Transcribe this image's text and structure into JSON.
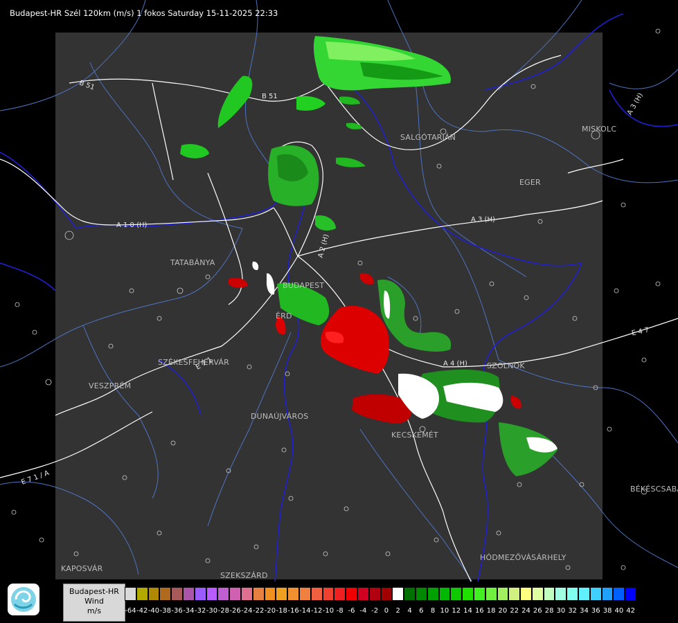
{
  "title": "Budapest-HR Szél 120km (m/s) 1 fokos Saturday 15-11-2025 22:33",
  "cities": [
    {
      "name": "SALGÓTARJÁN"
    },
    {
      "name": "MISKOLC"
    },
    {
      "name": "EGER"
    },
    {
      "name": "TATABÁNYA"
    },
    {
      "name": "BUDAPEST"
    },
    {
      "name": "ÉRD"
    },
    {
      "name": "SZÉKESFEHÉRVÁR"
    },
    {
      "name": "VESZPRÉM"
    },
    {
      "name": "DUNAÚJVÁROS"
    },
    {
      "name": "KECSKEMÉT"
    },
    {
      "name": "SZOLNOK"
    },
    {
      "name": "BÉKÉSCSABA"
    },
    {
      "name": "HÓDMEZŐVÁSÁRHELY"
    },
    {
      "name": "KAPOSVÁR"
    },
    {
      "name": "SZEKSZÁRD"
    }
  ],
  "roads": [
    {
      "name": "B 51"
    },
    {
      "name": "B 51"
    },
    {
      "name": "A 3 (H)"
    },
    {
      "name": "A 3 (H)"
    },
    {
      "name": "A 1 0 (H)"
    },
    {
      "name": "A 2 (H)"
    },
    {
      "name": "A 4 (H)"
    },
    {
      "name": "E 4 7"
    },
    {
      "name": "E 7 1"
    },
    {
      "name": "E 7 1 / A"
    }
  ],
  "legend": {
    "line1": "Budapest-HR",
    "line2": "Wind",
    "line3": "m/s",
    "scale_labels": [
      "-64",
      "-42",
      "-40",
      "-38",
      "-36",
      "-34",
      "-32",
      "-30",
      "-28",
      "-26",
      "-24",
      "-22",
      "-20",
      "-18",
      "-16",
      "-14",
      "-12",
      "-10",
      "-8",
      "-6",
      "-4",
      "-2",
      "0",
      "2",
      "4",
      "6",
      "8",
      "10",
      "12",
      "14",
      "16",
      "18",
      "20",
      "22",
      "24",
      "26",
      "28",
      "30",
      "32",
      "34",
      "36",
      "38",
      "40",
      "42"
    ],
    "scale_colors": [
      "#d9d9d9",
      "#b3aa00",
      "#b08900",
      "#b06a1e",
      "#a85a5a",
      "#aa55aa",
      "#9b5cff",
      "#b85cff",
      "#c060d0",
      "#d060b0",
      "#e07090",
      "#e88040",
      "#f09020",
      "#f0a020",
      "#f09030",
      "#f08040",
      "#f06040",
      "#f04030",
      "#f02020",
      "#f00000",
      "#d00020",
      "#b00010",
      "#a00000",
      "#ffffff",
      "#007000",
      "#008800",
      "#00a000",
      "#00b800",
      "#10c800",
      "#20e000",
      "#40f020",
      "#70f040",
      "#a0f060",
      "#d0f080",
      "#ffff80",
      "#e0ffa0",
      "#c0ffc0",
      "#a0ffe0",
      "#80fff0",
      "#60f0ff",
      "#40d0ff",
      "#20a0ff",
      "#0060ff",
      "#0000ff"
    ]
  },
  "colors": {
    "radar_dark": "#333333",
    "river": "#2222cc",
    "border_blue": "#5078c8",
    "road": "#ffffff",
    "outflow_red": "#dd0000",
    "inflow_green": "#22cc22"
  }
}
